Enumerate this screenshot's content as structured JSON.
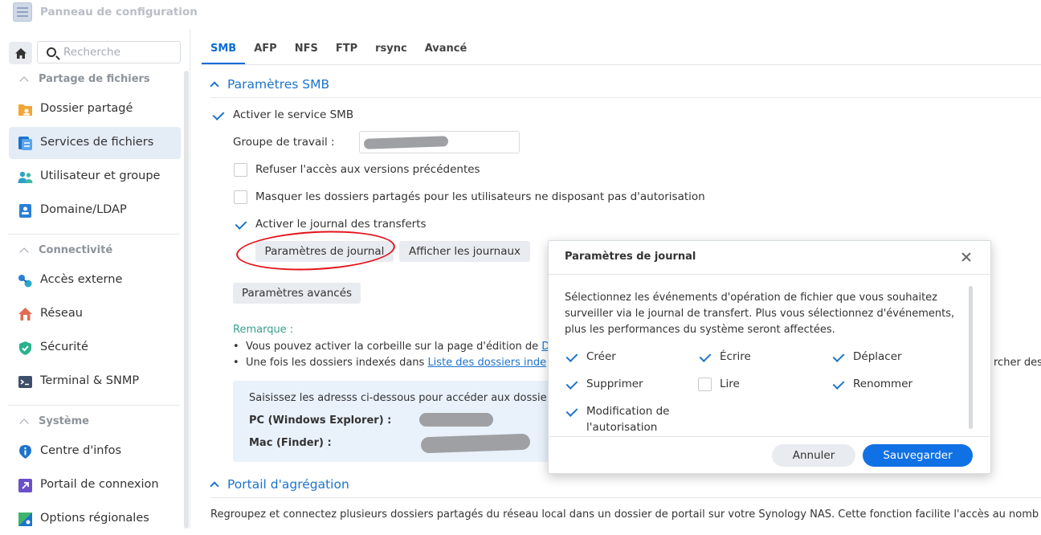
{
  "window": {
    "title": "Panneau de configuration"
  },
  "search": {
    "placeholder": "Recherche"
  },
  "sidebar": {
    "sections": [
      {
        "label": "Partage de fichiers"
      },
      {
        "label": "Connectivité"
      },
      {
        "label": "Système"
      }
    ],
    "items": [
      {
        "label": "Dossier partagé",
        "icon": "shared-folder-icon"
      },
      {
        "label": "Services de fichiers",
        "icon": "file-services-icon",
        "active": true
      },
      {
        "label": "Utilisateur et groupe",
        "icon": "users-icon"
      },
      {
        "label": "Domaine/LDAP",
        "icon": "domain-icon"
      },
      {
        "label": "Accès externe",
        "icon": "external-access-icon"
      },
      {
        "label": "Réseau",
        "icon": "network-house-icon"
      },
      {
        "label": "Sécurité",
        "icon": "shield-icon"
      },
      {
        "label": "Terminal & SNMP",
        "icon": "terminal-icon"
      },
      {
        "label": "Centre d'infos",
        "icon": "info-icon"
      },
      {
        "label": "Portail de connexion",
        "icon": "login-portal-icon"
      },
      {
        "label": "Options régionales",
        "icon": "regional-options-icon"
      }
    ]
  },
  "tabs": [
    "SMB",
    "AFP",
    "NFS",
    "FTP",
    "rsync",
    "Avancé"
  ],
  "smb": {
    "heading": "Paramètres SMB",
    "enable_service": "Activer le service SMB",
    "workgroup_label": "Groupe de travail :",
    "deny_previous": "Refuser l'accès aux versions précédentes",
    "hide_shared": "Masquer les dossiers partagés pour les utilisateurs ne disposant pas d'autorisation",
    "enable_log": "Activer le journal des transferts",
    "log_settings_btn": "Paramètres de journal",
    "show_logs_btn": "Afficher les journaux",
    "advanced_btn": "Paramètres avancés",
    "remark_label": "Remarque :",
    "bullet1": "Vous pouvez activer la corbeille sur la page d'édition de",
    "bullet1_link": "D",
    "bullet2": "Une fois les dossiers indexés dans",
    "bullet2_link": "Liste des dossiers inde",
    "bullet2_tail": "rcher des",
    "info_text": "Saisissez les adresss ci-dessous pour accéder aux dossie",
    "pc_label": "PC (Windows Explorer) :",
    "mac_label": "Mac (Finder) :"
  },
  "portal": {
    "heading": "Portail d'agrégation",
    "text": "Regroupez et connectez plusieurs dossiers partagés du réseau local dans un dossier de portail sur votre Synology NAS. Cette fonction facilite l'accès au nomb"
  },
  "dialog": {
    "title": "Paramètres de journal",
    "description": "Sélectionnez les événements d'opération de fichier que vous souhaitez surveiller via le journal de transfert. Plus vous sélectionnez d'événements, plus les performances du système seront affectées.",
    "options": [
      {
        "label": "Créer",
        "checked": true
      },
      {
        "label": "Écrire",
        "checked": true
      },
      {
        "label": "Déplacer",
        "checked": true
      },
      {
        "label": "Supprimer",
        "checked": true
      },
      {
        "label": "Lire",
        "checked": false
      },
      {
        "label": "Renommer",
        "checked": true
      },
      {
        "label_line1": "Modification de",
        "label_line2": "l'autorisation",
        "checked": true
      }
    ],
    "cancel": "Annuler",
    "save": "Sauvegarder"
  }
}
